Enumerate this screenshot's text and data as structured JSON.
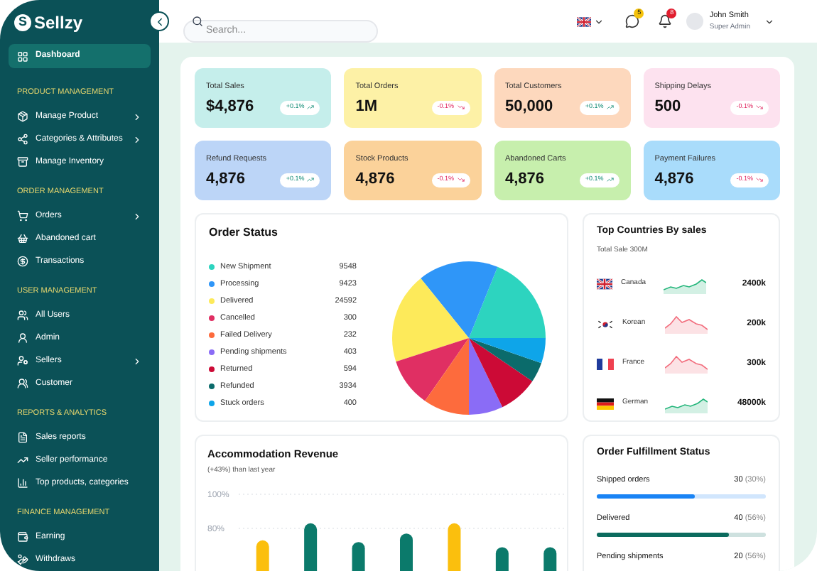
{
  "sidebar": {
    "logo_mark": "S",
    "logo": "Sellzy",
    "sections": [
      {
        "items": [
          {
            "label": "Dashboard",
            "selected": true,
            "has_submenu": false
          }
        ]
      },
      {
        "title": "PRODUCT MANAGEMENT",
        "items": [
          {
            "label": "Manage Product",
            "selected": false,
            "has_submenu": true
          },
          {
            "label": "Categories & Attributes",
            "selected": false,
            "has_submenu": true
          },
          {
            "label": "Manage Inventory",
            "selected": false,
            "has_submenu": false
          }
        ]
      },
      {
        "title": "ORDER MANAGEMENT",
        "items": [
          {
            "label": "Orders",
            "selected": false,
            "has_submenu": true
          },
          {
            "label": "Abandoned cart",
            "selected": false,
            "has_submenu": false
          },
          {
            "label": "Transactions",
            "selected": false,
            "has_submenu": false
          }
        ]
      },
      {
        "title": "USER MANAGEMENT",
        "items": [
          {
            "label": "All Users",
            "selected": false,
            "has_submenu": false
          },
          {
            "label": "Admin",
            "selected": false,
            "has_submenu": false
          },
          {
            "label": "Sellers",
            "selected": false,
            "has_submenu": true
          },
          {
            "label": "Customer",
            "selected": false,
            "has_submenu": false
          }
        ]
      },
      {
        "title": "REPORTS & ANALYTICS",
        "items": [
          {
            "label": "Sales reports",
            "selected": false,
            "has_submenu": false
          },
          {
            "label": "Seller performance",
            "selected": false,
            "has_submenu": false
          },
          {
            "label": "Top products, categories",
            "selected": false,
            "has_submenu": false
          }
        ]
      },
      {
        "title": "FINANCE MANAGEMENT",
        "items": [
          {
            "label": "Earning",
            "selected": false,
            "has_submenu": false
          },
          {
            "label": "Withdraws",
            "selected": false,
            "has_submenu": false
          }
        ]
      }
    ]
  },
  "header": {
    "search": {
      "placeholder": "Search..."
    },
    "messages_badge": "5",
    "notifications_badge": "8",
    "user": {
      "name": "John Smith",
      "role": "Super Admin"
    }
  },
  "stats": [
    {
      "title": "Total Sales",
      "value": "$4,876",
      "change": "+0.1%",
      "rising": true,
      "color": "#c5eeeb"
    },
    {
      "title": "Total Orders",
      "value": "1M",
      "change": "-0.1%",
      "rising": false,
      "color": "#fdf1a6"
    },
    {
      "title": "Total Customers",
      "value": "50,000",
      "change": "+0.1%",
      "rising": true,
      "color": "#fdd8bd"
    },
    {
      "title": "Shipping Delays",
      "value": "500",
      "change": "-0.1%",
      "rising": false,
      "color": "#fde2ef"
    },
    {
      "title": "Refund Requests",
      "value": "4,876",
      "change": "+0.1%",
      "rising": true,
      "color": "#bcd5f7"
    },
    {
      "title": "Stock Products",
      "value": "4,876",
      "change": "-0.1%",
      "rising": false,
      "color": "#fbd29a"
    },
    {
      "title": "Abandoned Carts",
      "value": "4,876",
      "change": "+0.1%",
      "rising": true,
      "color": "#c7efad"
    },
    {
      "title": "Payment Failures",
      "value": "4,876",
      "change": "-0.1%",
      "rising": false,
      "color": "#a9dcfb"
    }
  ],
  "order_status": {
    "title": "Order Status",
    "legend": [
      {
        "value": "9548",
        "color": "#2dd4bf"
      },
      {
        "value": "9423",
        "color": "#2f96f8"
      },
      {
        "value": "24592",
        "color": "#fdea5a"
      },
      {
        "value": "300",
        "color": "#e02f63"
      },
      {
        "value": "232",
        "color": "#fd6b3d"
      },
      {
        "value": "403",
        "color": "#8a6cf6"
      },
      {
        "value": "594",
        "color": "#cc0a36"
      },
      {
        "value": "3934",
        "color": "#0b6b6b"
      },
      {
        "value": "400",
        "color": "#0ea5e9"
      }
    ],
    "chart_data": {
      "type": "pie",
      "categories": [
        "New Shipment",
        "Processing",
        "Delivered",
        "Cancelled",
        "Failed Delivery",
        "Pending shipments",
        "Returned",
        "Refunded",
        "Stuck orders"
      ],
      "series": [
        {
          "values": [
            18.9,
            16.9,
            19.2,
            10.3,
            9.7,
            7.2,
            8.3,
            4.2,
            5.3
          ]
        }
      ]
    }
  },
  "top_countries": {
    "title": "Top Countries By sales",
    "subtitle": "Total Sale 300M",
    "rows": [
      {
        "country": "Canada",
        "value": "2400k",
        "rising": true
      },
      {
        "country": "Korean",
        "value": "200k",
        "rising": false
      },
      {
        "country": "France",
        "value": "300k",
        "rising": false
      },
      {
        "country": "German",
        "value": "48000k",
        "rising": true
      }
    ]
  },
  "revenue": {
    "title": "Accommodation Revenue",
    "subtitle": "(+43%) than last year",
    "chart_data": {
      "type": "bar",
      "ylim": [
        0,
        100
      ],
      "yticks": [
        {
          "value": 100,
          "label": "100%"
        },
        {
          "value": 80,
          "label": "80%"
        }
      ],
      "series": [
        {
          "color": "#fbbf0d",
          "values": [
            73,
            null,
            null,
            null,
            83,
            null,
            null
          ]
        },
        {
          "color": "#0b7a6b",
          "values": [
            null,
            83,
            72,
            77,
            null,
            69,
            69
          ]
        }
      ]
    }
  },
  "fulfillment": {
    "title": "Order Fulfillment Status",
    "rows": [
      {
        "label": "Shipped orders",
        "count": "30",
        "percent": "(30%)",
        "level": 0.58,
        "color": "#1a84f5"
      },
      {
        "label": "Delivered",
        "count": "40",
        "percent": "(56%)",
        "level": 0.78,
        "color": "#0b6b5e"
      },
      {
        "label": "Pending shipments",
        "count": "20",
        "percent": "(56%)"
      }
    ]
  }
}
